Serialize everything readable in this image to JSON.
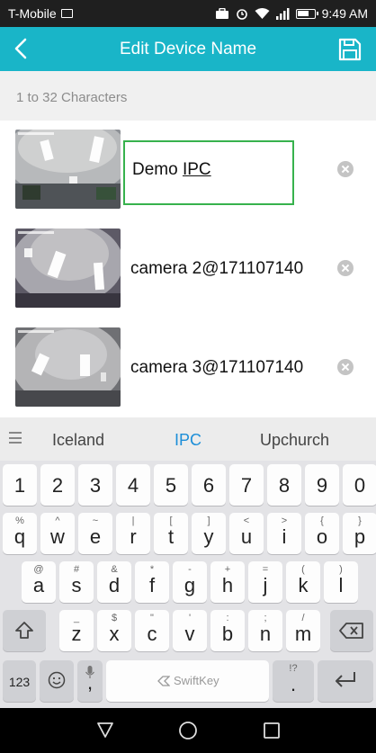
{
  "status_bar": {
    "carrier": "T-Mobile",
    "time": "9:49 AM",
    "battery_level": 0.7
  },
  "header": {
    "title": "Edit Device Name",
    "back_icon": "back-arrow-icon",
    "save_icon": "save-icon"
  },
  "hint": "1 to 32 Characters",
  "devices": [
    {
      "name_committed": "Demo ",
      "name_composing": "IPC"
    },
    {
      "name": "camera 2@171107140"
    },
    {
      "name": "camera 3@171107140"
    }
  ],
  "keyboard": {
    "suggestions": [
      "Iceland",
      "IPC",
      "Upchurch"
    ],
    "number_row": [
      "1",
      "2",
      "3",
      "4",
      "5",
      "6",
      "7",
      "8",
      "9",
      "0"
    ],
    "row1": [
      {
        "main": "q",
        "sub": "%"
      },
      {
        "main": "w",
        "sub": "^"
      },
      {
        "main": "e",
        "sub": "~"
      },
      {
        "main": "r",
        "sub": "|"
      },
      {
        "main": "t",
        "sub": "["
      },
      {
        "main": "y",
        "sub": "]"
      },
      {
        "main": "u",
        "sub": "<"
      },
      {
        "main": "i",
        "sub": ">"
      },
      {
        "main": "o",
        "sub": "{"
      },
      {
        "main": "p",
        "sub": "}"
      }
    ],
    "row2": [
      {
        "main": "a",
        "sub": "@"
      },
      {
        "main": "s",
        "sub": "#"
      },
      {
        "main": "d",
        "sub": "&"
      },
      {
        "main": "f",
        "sub": "*"
      },
      {
        "main": "g",
        "sub": "-"
      },
      {
        "main": "h",
        "sub": "+"
      },
      {
        "main": "j",
        "sub": "="
      },
      {
        "main": "k",
        "sub": "("
      },
      {
        "main": "l",
        "sub": ")"
      }
    ],
    "row3": [
      {
        "main": "z",
        "sub": "_"
      },
      {
        "main": "x",
        "sub": "$"
      },
      {
        "main": "c",
        "sub": "\""
      },
      {
        "main": "v",
        "sub": "'"
      },
      {
        "main": "b",
        "sub": ":"
      },
      {
        "main": "n",
        "sub": ";"
      },
      {
        "main": "m",
        "sub": "/"
      }
    ],
    "symbols_label": "123",
    "space_label": "SwiftKey",
    "period_sub": "!?",
    "period_main": ".",
    "comma_sub": "",
    "shift_icon": "shift-icon",
    "backspace_icon": "backspace-icon",
    "enter_icon": "enter-icon",
    "emoji_icon": "emoji-icon",
    "mic_icon": "microphone-icon"
  },
  "colors": {
    "accent": "#19b5c8",
    "edit_border": "#37b24d",
    "suggestion_highlight": "#1c8ed8"
  }
}
